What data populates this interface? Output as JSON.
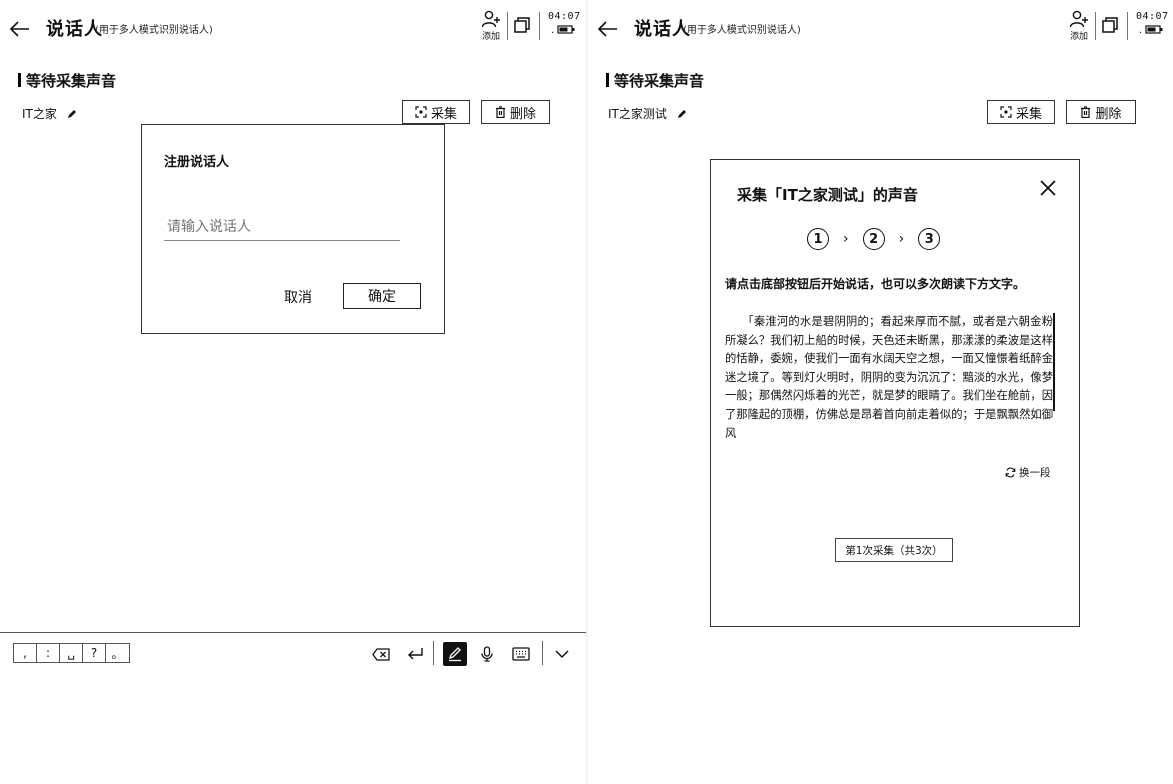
{
  "left": {
    "header": {
      "title": "说话人",
      "subtitle": "(用于多人模式识别说话人)",
      "add_label": "添加",
      "time": "04:07",
      "status_dot": "."
    },
    "section_heading": "等待采集声音",
    "speaker_name": "IT之家",
    "capture_button": "采集",
    "delete_button": "删除",
    "dialog": {
      "title": "注册说话人",
      "placeholder": "请输入说话人",
      "cancel": "取消",
      "ok": "确定"
    },
    "keyboard_toolbar": {
      "punctuation": [
        ",",
        ":",
        "␣",
        "?",
        "。"
      ]
    }
  },
  "right": {
    "header": {
      "title": "说话人",
      "subtitle": "(用于多人模式识别说话人)",
      "add_label": "添加",
      "time": "04:07",
      "status_dot": "."
    },
    "section_heading": "等待采集声音",
    "speaker_name": "IT之家测试",
    "capture_button": "采集",
    "delete_button": "删除",
    "modal": {
      "title": "采集「IT之家测试」的声音",
      "steps": [
        "1",
        "2",
        "3"
      ],
      "instruction": "请点击底部按钮后开始说话，也可以多次朗读下方文字。",
      "reading_text": "　　「秦淮河的水是碧阴阴的；看起来厚而不腻，或者是六朝金粉所凝么？我们初上船的时候，天色还未断黑，那漾漾的柔波是这样的恬静，委婉，使我们一面有水阔天空之想，一面又憧憬着纸醉金迷之境了。等到灯火明时，阴阴的变为沉沉了：黯淡的水光，像梦一般；那偶然闪烁着的光芒，就是梦的眼睛了。我们坐在舱前，因了那隆起的顶棚，仿佛总是昂着首向前走着似的；于是飘飘然如御风",
      "shuffle": "换一段",
      "capture_count": "第1次采集（共3次）"
    }
  }
}
